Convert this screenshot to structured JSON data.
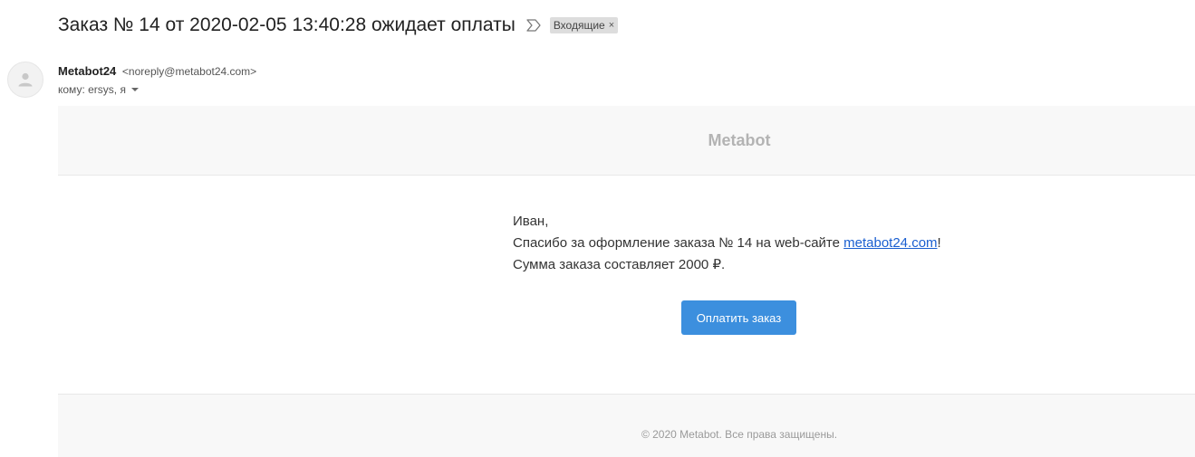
{
  "email": {
    "subject": "Заказ № 14 от 2020-02-05 13:40:28 ожидает оплаты",
    "label": "Входящие",
    "label_remove": "×",
    "sender_name": "Metabot24",
    "sender_email": "<noreply@metabot24.com>",
    "recipients": "кому: ersys, я"
  },
  "message": {
    "brand": "Metabot",
    "greeting": "Иван,",
    "thanks_before": "Спасибо за оформление заказа № 14 на web-сайте ",
    "link_text": "metabot24.com",
    "thanks_after": "!",
    "sum_line": "Сумма заказа составляет 2000 ₽.",
    "pay_button": "Оплатить заказ",
    "copyright": "© 2020 Metabot. Все права защищены."
  },
  "colors": {
    "button_bg": "#3c8fde",
    "link": "#1a5fd0",
    "brand_text": "#b3b3b3"
  },
  "icons": [
    "importance-marker-icon",
    "person-avatar-icon",
    "dropdown-caret-icon"
  ]
}
